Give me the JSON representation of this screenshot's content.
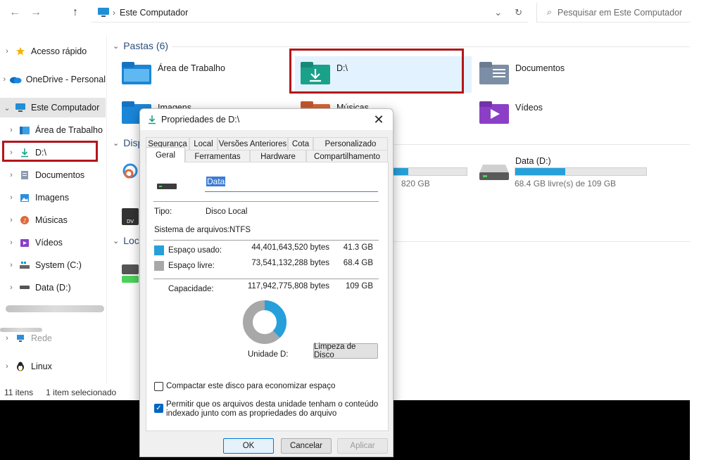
{
  "toolbar": {
    "back_icon": "arrow-left-icon",
    "forward_icon": "arrow-right-icon",
    "up_icon": "arrow-up-icon",
    "address": "Este Computador",
    "search_placeholder": "Pesquisar em Este Computador"
  },
  "sidebar": {
    "items": [
      {
        "label": "Acesso rápido",
        "icon": "star-icon"
      },
      {
        "label": "OneDrive - Personal",
        "icon": "cloud-icon"
      },
      {
        "label": "Este Computador",
        "icon": "monitor-icon"
      },
      {
        "label": "Área de Trabalho",
        "icon": "desktop-folder-icon"
      },
      {
        "label": "D:\\",
        "icon": "download-arrow-icon"
      },
      {
        "label": "Documentos",
        "icon": "document-icon"
      },
      {
        "label": "Imagens",
        "icon": "image-icon"
      },
      {
        "label": "Músicas",
        "icon": "music-icon"
      },
      {
        "label": "Vídeos",
        "icon": "video-icon"
      },
      {
        "label": "System (C:)",
        "icon": "windows-drive-icon"
      },
      {
        "label": "Data (D:)",
        "icon": "drive-icon"
      },
      {
        "label": "Rede",
        "icon": "network-icon"
      },
      {
        "label": "Linux",
        "icon": "penguin-icon"
      }
    ]
  },
  "main": {
    "folders_heading": "Pastas (6)",
    "devices_heading": "Disp",
    "locations_heading": "Loc",
    "folders": [
      {
        "label": "Área de Trabalho"
      },
      {
        "label": "D:\\"
      },
      {
        "label": "Documentos"
      },
      {
        "label": "Imagens"
      },
      {
        "label": "Músicas"
      },
      {
        "label": "Vídeos"
      }
    ],
    "drive_c_free": "820 GB",
    "drive_d": {
      "label": "Data (D:)",
      "free": "68.4 GB livre(s) de 109 GB",
      "used_fraction": 0.38
    },
    "drive_c_used_fraction": 0.2
  },
  "status": {
    "items": "11 itens",
    "selected": "1 item selecionado"
  },
  "dialog": {
    "title": "Propriedades de D:\\",
    "tabs_row1": [
      "Segurança",
      "Local",
      "Versões Anteriores",
      "Cota",
      "Personalizado"
    ],
    "tabs_row2": [
      "Geral",
      "Ferramentas",
      "Hardware",
      "Compartilhamento"
    ],
    "name_value": "Data",
    "tipo_label": "Tipo:",
    "tipo_value": "Disco Local",
    "fs_label": "Sistema de arquivos:",
    "fs_value": "NTFS",
    "used_label": "Espaço usado:",
    "used_bytes": "44,401,643,520 bytes",
    "used_gb": "41.3 GB",
    "free_label": "Espaço livre:",
    "free_bytes": "73,541,132,288 bytes",
    "free_gb": "68.4 GB",
    "cap_label": "Capacidade:",
    "cap_bytes": "117,942,775,808 bytes",
    "cap_gb": "109 GB",
    "used_fraction": 0.376,
    "unit_label": "Unidade D:",
    "cleanup_button": "Limpeza de Disco",
    "compress_label": "Compactar este disco para economizar espaço",
    "compress_checked": false,
    "index_label_1": "Permitir que os arquivos desta unidade tenham o conteúdo",
    "index_label_2": "indexado junto com as propriedades do arquivo",
    "index_checked": true,
    "ok": "OK",
    "cancel": "Cancelar",
    "apply": "Aplicar"
  },
  "colors": {
    "used": "#26a0da",
    "free": "#a8a8a8",
    "highlight_box": "#b3161c"
  }
}
